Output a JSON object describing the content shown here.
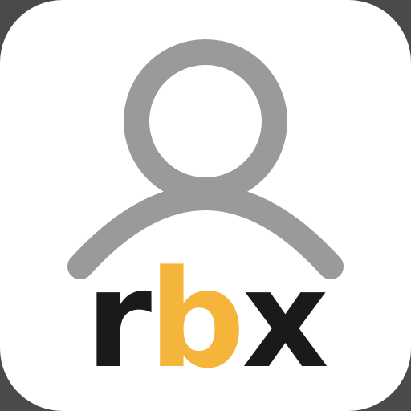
{
  "logo": {
    "letters": [
      {
        "text": "r",
        "color": "#1a1a1a"
      },
      {
        "text": "b",
        "color": "#f5b53b"
      },
      {
        "text": "x",
        "color": "#1a1a1a"
      }
    ]
  },
  "icon": {
    "name": "user-icon",
    "color": "#999a9c",
    "background": "#ffffff"
  }
}
